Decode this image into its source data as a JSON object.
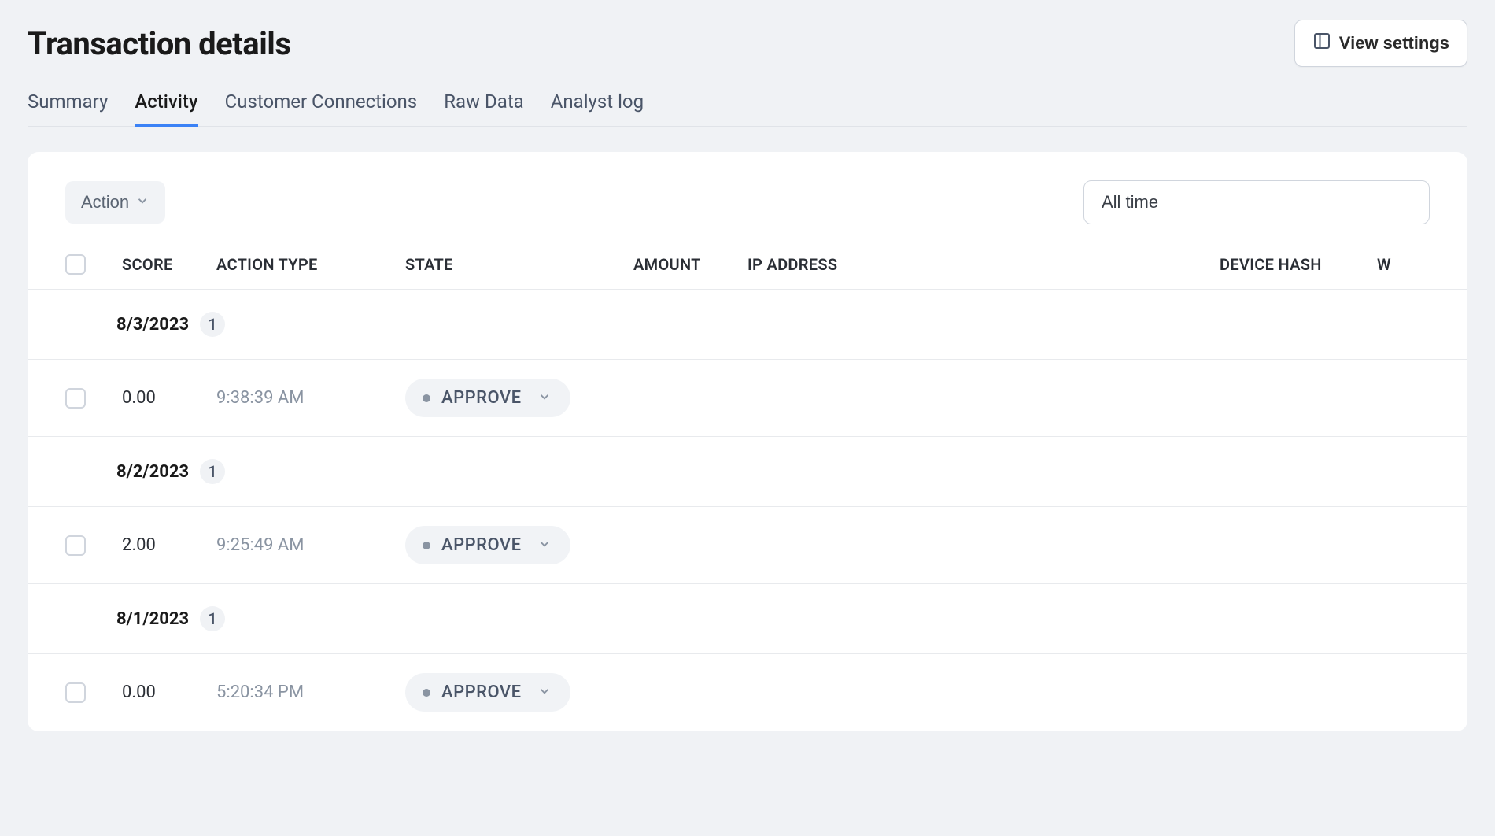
{
  "header": {
    "title": "Transaction details",
    "view_settings_label": "View settings"
  },
  "tabs": [
    {
      "label": "Summary",
      "active": false
    },
    {
      "label": "Activity",
      "active": true
    },
    {
      "label": "Customer Connections",
      "active": false
    },
    {
      "label": "Raw Data",
      "active": false
    },
    {
      "label": "Analyst log",
      "active": false
    }
  ],
  "toolbar": {
    "action_label": "Action",
    "time_filter": "All time"
  },
  "table": {
    "columns": {
      "score": "SCORE",
      "action_type": "ACTION TYPE",
      "state": "STATE",
      "amount": "AMOUNT",
      "ip_address": "IP ADDRESS",
      "device_hash": "DEVICE HASH",
      "w": "W"
    },
    "groups": [
      {
        "date": "8/3/2023",
        "count": "1",
        "rows": [
          {
            "score": "0.00",
            "time": "9:38:39 AM",
            "state": "APPROVE"
          }
        ]
      },
      {
        "date": "8/2/2023",
        "count": "1",
        "rows": [
          {
            "score": "2.00",
            "time": "9:25:49 AM",
            "state": "APPROVE"
          }
        ]
      },
      {
        "date": "8/1/2023",
        "count": "1",
        "rows": [
          {
            "score": "0.00",
            "time": "5:20:34 PM",
            "state": "APPROVE"
          }
        ]
      }
    ]
  }
}
